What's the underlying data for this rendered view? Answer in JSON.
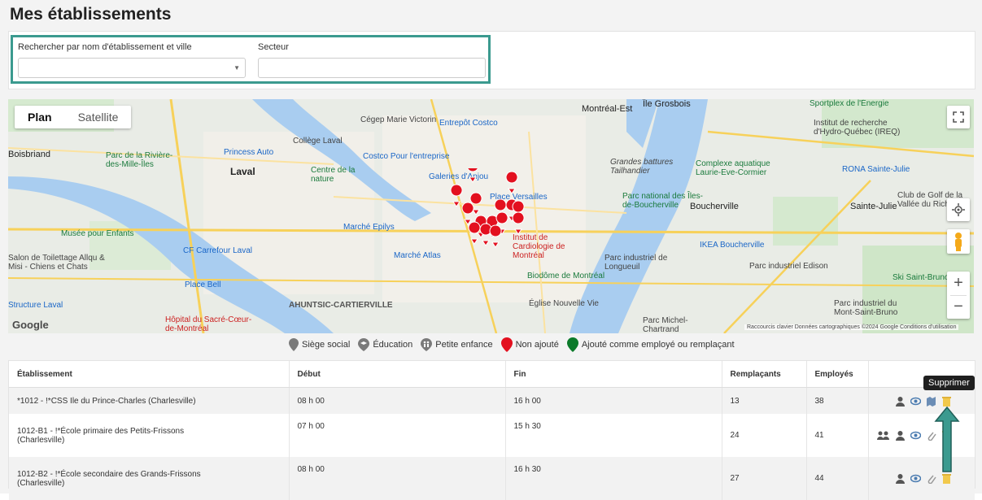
{
  "page": {
    "title": "Mes établissements"
  },
  "filters": {
    "search_label": "Rechercher par nom d'établissement et ville",
    "search_value": "",
    "sector_label": "Secteur",
    "sector_value": ""
  },
  "map": {
    "maptype": [
      "Plan",
      "Satellite"
    ],
    "labels": {
      "montreal_est": "Montréal-Est",
      "grosbois": "Île Grosbois",
      "sportplex": "Sportplex de l'Énergie",
      "cegep": "Cégep Marie Victorin",
      "entrepot": "Entrepôt Costco",
      "laval": "Laval",
      "college_laval": "Collège Laval",
      "princess": "Princess Auto",
      "costco_ent": "Costco Pour l'entreprise",
      "parc_riviere": "Parc de la Rivière-des-Mille-Îles",
      "centre_nature": "Centre de la nature",
      "galeries": "Galeries d'Anjou",
      "place_versailles": "Place Versailles",
      "grandes_battures": "Grandes battures Tailhandier",
      "parc_boucherville": "Parc national des Îles-de-Boucherville",
      "boucherville": "Boucherville",
      "complexe": "Complexe aquatique Laurie-Eve-Cormier",
      "institut": "Institut de recherche d'Hydro-Québec (IREQ)",
      "rona": "RONA Sainte-Julie",
      "sainte_julie": "Sainte-Julie",
      "club_golf": "Club de Golf de la Vallée du Richelieu",
      "boisbriand": "Boisbriand",
      "musee": "Musée pour Enfants",
      "cf_carrefour": "CF Carrefour Laval",
      "salon": "Salon de Toilettage Allqu & Misi - Chiens et Chats",
      "marche_epilys": "Marché Epilys",
      "marche_atlas": "Marché Atlas",
      "cardiologie": "Institut de Cardiologie de Montréal",
      "ikea": "IKEA Boucherville",
      "parc_longueuil": "Parc industriel de Longueuil",
      "parc_edison": "Parc industriel Edison",
      "biodome": "Biodôme de Montréal",
      "place_bell": "Place Bell",
      "ahuntsic": "AHUNTSIC-CARTIERVILLE",
      "eglise": "Église Nouvelle Vie",
      "parc_michel": "Parc Michel-Chartrand",
      "ski": "Ski Saint-Bruno",
      "parc_mont": "Parc industriel du Mont-Saint-Bruno",
      "hopital": "Hôpital du Sacré-Cœur-de-Montréal",
      "structure": "Structure Laval",
      "google": "Google",
      "attribution": "Raccourcis clavier   Données cartographiques ©2024 Google   Conditions d'utilisation"
    }
  },
  "legend": [
    {
      "label": "Siège social",
      "color": "#7a7a7a",
      "icon": "pin-icon"
    },
    {
      "label": "Éducation",
      "color": "#7a7a7a",
      "icon": "graduation-icon"
    },
    {
      "label": "Petite enfance",
      "color": "#7a7a7a",
      "icon": "children-icon"
    },
    {
      "label": "Non ajouté",
      "color": "#e3101f",
      "icon": "pin-icon"
    },
    {
      "label": "Ajouté comme employé ou remplaçant",
      "color": "#0b7a2a",
      "icon": "pin-icon"
    }
  ],
  "table": {
    "headers": [
      "Établissement",
      "Début",
      "Fin",
      "Remplaçants",
      "Employés",
      ""
    ],
    "rows": [
      {
        "etablissement": "*1012 - !*CSS Ile du Prince-Charles (Charlesville)",
        "debut": "08 h 00",
        "fin": "16 h 00",
        "remplacants": "13",
        "employes": "38"
      },
      {
        "etablissement_line1": "1012-B1 - !*École primaire des Petits-Frissons",
        "etablissement_line2": "(Charlesville)",
        "debut": "07 h 00",
        "fin": "15 h 30",
        "remplacants": "24",
        "employes": "41"
      },
      {
        "etablissement_line1": "1012-B2 - !*École secondaire des Grands-Frissons",
        "etablissement_line2": "(Charlesville)",
        "debut": "08 h 00",
        "fin": "16 h 30",
        "remplacants": "27",
        "employes": "44"
      }
    ]
  },
  "tooltip": {
    "text": "Supprimer"
  },
  "colors": {
    "accent": "#3b9a8f",
    "red_marker": "#e3101f",
    "green_marker": "#0b7a2a"
  }
}
